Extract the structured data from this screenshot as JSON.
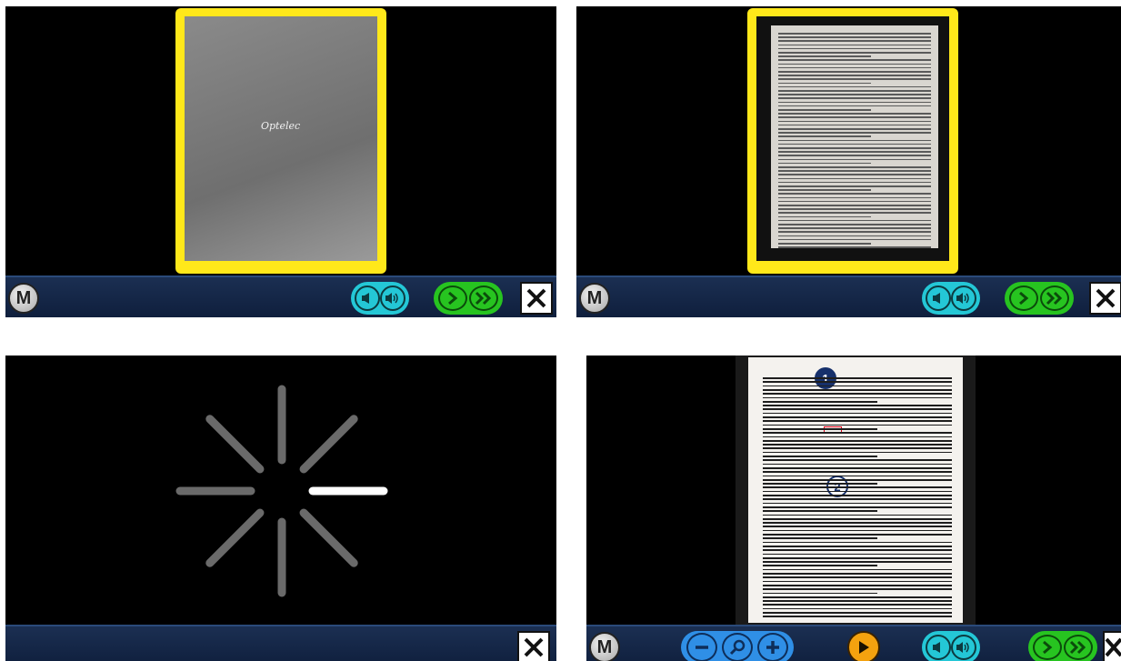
{
  "panels": [
    {
      "id": "capture-preview",
      "logo_text": "Optelec",
      "toolbar": {
        "menu_label": "M"
      }
    },
    {
      "id": "document-preview",
      "toolbar": {
        "menu_label": "M"
      }
    },
    {
      "id": "processing",
      "spinner": {
        "segments": 8,
        "active_segment": 2
      }
    },
    {
      "id": "reading-view",
      "toolbar": {
        "menu_label": "M"
      },
      "markers": [
        {
          "label": "1"
        },
        {
          "label": "2"
        }
      ]
    }
  ],
  "icons": {
    "menu": "menu-m-icon",
    "speaker_low": "volume-down-icon",
    "speaker_high": "volume-up-icon",
    "next": "next-icon",
    "fast_forward": "fast-forward-icon",
    "close": "close-icon",
    "zoom_out": "zoom-out-icon",
    "magnifier": "magnifier-icon",
    "zoom_in": "zoom-in-icon",
    "play": "play-icon"
  },
  "colors": {
    "frame": "#ffe81a",
    "toolbar": "#13254a",
    "volume": "#24c7d6",
    "navigation": "#27c420",
    "zoom": "#2f8fe6",
    "play": "#f4a20f",
    "marker": "#16306b",
    "highlight": "#e0001a"
  }
}
